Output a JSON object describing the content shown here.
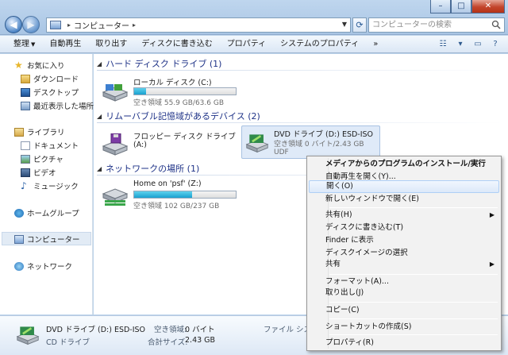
{
  "window": {
    "breadcrumb": "コンピューター",
    "search_placeholder": "コンピューターの検索"
  },
  "toolbar": {
    "items": [
      "整理",
      "自動再生",
      "取り出す",
      "ディスクに書き込む",
      "プロパティ",
      "システムのプロパティ",
      "»"
    ]
  },
  "sidebar": {
    "favorites": "お気に入り",
    "downloads": "ダウンロード",
    "desktop": "デスクトップ",
    "recent": "最近表示した場所",
    "libraries": "ライブラリ",
    "documents": "ドキュメント",
    "pictures": "ピクチャ",
    "videos": "ビデオ",
    "music": "ミュージック",
    "homegroup": "ホームグループ",
    "computer": "コンピューター",
    "network": "ネットワーク"
  },
  "groups": {
    "hdd": "ハード ディスク ドライブ (1)",
    "removable": "リムーバブル記憶域があるデバイス (2)",
    "network": "ネットワークの場所 (1)"
  },
  "drives": {
    "local_c": {
      "name": "ローカル ディスク (C:)",
      "free": "空き領域 55.9 GB/63.6 GB",
      "used_fraction": 0.12
    },
    "floppy": {
      "name_line1": "フロッピー ディスク ドライブ",
      "name_line2": "(A:)"
    },
    "dvd": {
      "name": "DVD ドライブ (D:) ESD-ISO",
      "free": "空き領域 0 バイト/2.43 GB",
      "fs": "UDF"
    },
    "psf": {
      "name": "Home on 'psf' (Z:)",
      "free": "空き領域 102 GB/237 GB",
      "used_fraction": 0.57
    }
  },
  "details": {
    "name": "DVD ドライブ (D:) ESD-ISO",
    "type": "CD ドライブ",
    "free_label": "空き領域:",
    "free_value": "0 バイト",
    "total_label": "合計サイズ:",
    "total_value": "2.43 GB",
    "fs_label": "ファイル システ"
  },
  "context_menu": {
    "install": "メディアからのプログラムのインストール/実行",
    "autoplay": "自動再生を開く(Y)...",
    "open": "開く(O)",
    "open_new_window": "新しいウィンドウで開く(E)",
    "share": "共有(H)",
    "burn": "ディスクに書き込む(T)",
    "finder": "Finder に表示",
    "select_image": "ディスクイメージの選択",
    "share2": "共有",
    "format": "フォーマット(A)...",
    "eject": "取り出し(J)",
    "copy": "コピー(C)",
    "shortcut": "ショートカットの作成(S)",
    "properties": "プロパティ(R)"
  }
}
